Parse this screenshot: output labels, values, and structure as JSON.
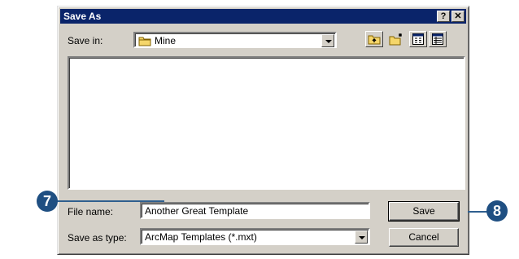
{
  "dialog": {
    "title": "Save As",
    "help_btn": "?",
    "close_btn": "✕",
    "save_in_label": "Save in:",
    "save_in_value": "Mine",
    "file_name_label": "File name:",
    "file_name_value": "Another Great Template",
    "save_as_type_label": "Save as type:",
    "save_as_type_value": "ArcMap Templates (*.mxt)",
    "save_button": "Save",
    "cancel_button": "Cancel"
  },
  "toolbar_icons": [
    "up-one-level-icon",
    "create-new-folder-icon",
    "list-view-icon",
    "details-view-icon"
  ],
  "callouts": {
    "file_name_step": "7",
    "save_step": "8"
  },
  "colors": {
    "title_bar": "#0a246a",
    "dialog_face": "#d4d0c8",
    "callout": "#1f4f82"
  }
}
